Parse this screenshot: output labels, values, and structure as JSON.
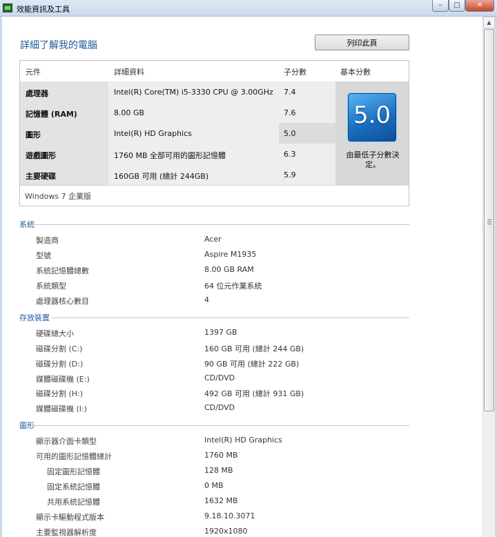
{
  "window": {
    "title": "效能資訊及工具",
    "buttons": {
      "minimize": "–",
      "maximize": "□",
      "close": "✕"
    }
  },
  "page": {
    "heading": "詳細了解我的電腦",
    "print_label": "列印此頁"
  },
  "score_table": {
    "headers": {
      "component": "元件",
      "details": "詳細資料",
      "subscore": "子分數",
      "base": "基本分數"
    },
    "rows": [
      {
        "name": "處理器",
        "detail": "Intel(R) Core(TM) i5-3330 CPU @ 3.00GHz",
        "subscore": "7.4"
      },
      {
        "name": "記憶體 (RAM)",
        "detail": "8.00 GB",
        "subscore": "7.6"
      },
      {
        "name": "圖形",
        "detail": "Intel(R) HD Graphics",
        "subscore": "5.0"
      },
      {
        "name": "遊戲圖形",
        "detail": "1760 MB 全部可用的圖形記憶體",
        "subscore": "6.3"
      },
      {
        "name": "主要硬碟",
        "detail": "160GB 可用 (總計 244GB)",
        "subscore": "5.9"
      }
    ],
    "base_score": "5.0",
    "base_caption": "由最低子分數決定。",
    "os_edition": "Windows 7 企業版"
  },
  "system": {
    "title": "系統",
    "items": [
      {
        "label": "製造商",
        "value": "Acer"
      },
      {
        "label": "型號",
        "value": "Aspire M1935"
      },
      {
        "label": "系統記憶體總數",
        "value": "8.00 GB RAM"
      },
      {
        "label": "系統類型",
        "value": "64 位元作業系統"
      },
      {
        "label": "處理器核心數目",
        "value": "4"
      }
    ]
  },
  "storage": {
    "title": "存放裝置",
    "items": [
      {
        "label": "硬碟總大小",
        "value": "1397 GB"
      },
      {
        "label": "磁碟分割 (C:)",
        "value": "160 GB 可用 (總計 244 GB)"
      },
      {
        "label": "磁碟分割 (D:)",
        "value": "90 GB 可用 (總計 222 GB)"
      },
      {
        "label": "媒體磁碟機 (E:)",
        "value": "CD/DVD"
      },
      {
        "label": "磁碟分割 (H:)",
        "value": "492 GB 可用 (總計 931 GB)"
      },
      {
        "label": "媒體磁碟機 (I:)",
        "value": "CD/DVD"
      }
    ]
  },
  "graphics": {
    "title": "圖形",
    "items": [
      {
        "label": "顯示器介面卡類型",
        "value": "Intel(R) HD Graphics"
      },
      {
        "label": "可用的圖形記憶體總計",
        "value": "1760 MB"
      },
      {
        "label": "固定圖形記憶體",
        "value": "128 MB"
      },
      {
        "label": "固定系統記憶體",
        "value": "0 MB"
      },
      {
        "label": "共用系統記憶體",
        "value": "1632 MB"
      },
      {
        "label": "顯示卡驅動程式版本",
        "value": "9.18.10.3071"
      },
      {
        "label": "主要監視器解析度",
        "value": "1920x1080"
      }
    ]
  }
}
